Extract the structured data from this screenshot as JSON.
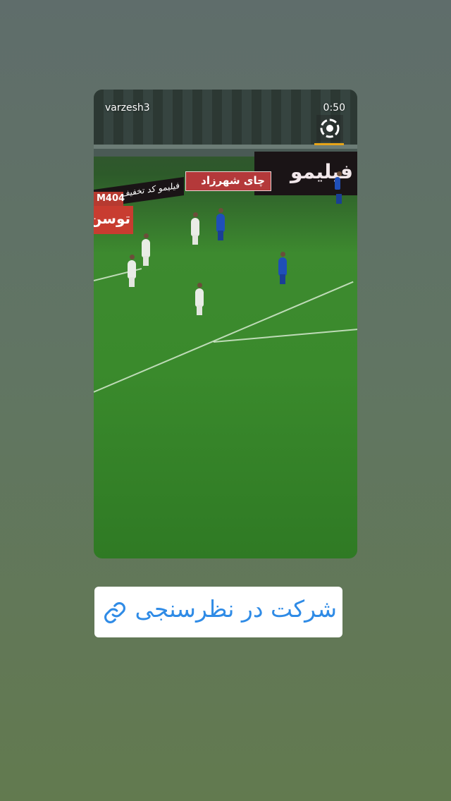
{
  "story": {
    "username": "varzesh3",
    "time": "0:50",
    "logo_icon": "varzesh3-logo-icon"
  },
  "scene": {
    "board_right_text": "فیلیمو",
    "board_mid_text": "چای شهرزاد",
    "board_left_text": "فیلیمو کد تخفیف",
    "board_m404_text": "M404",
    "board_tusan_text": "توسن"
  },
  "poll_link": {
    "label": "شرکت در نظرسنجی",
    "icon": "link-icon",
    "accent_color": "#2f8be6"
  }
}
